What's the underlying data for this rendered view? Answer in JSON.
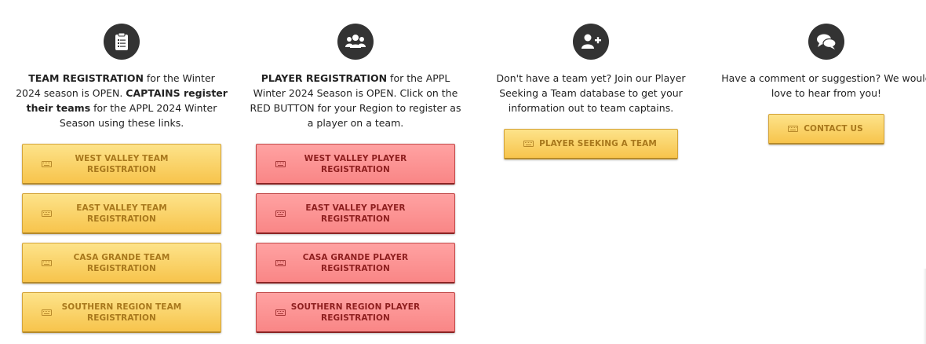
{
  "team": {
    "icon": "clipboard-icon",
    "desc_bold1": "TEAM REGISTRATION",
    "desc_text1": " for the Winter 2024 season is OPEN.  ",
    "desc_bold2": "CAPTAINS register their teams",
    "desc_text2": " for the APPL 2024 Winter Season using these links.",
    "buttons": [
      {
        "label": "WEST VALLEY TEAM REGISTRATION"
      },
      {
        "label": "EAST VALLEY TEAM REGISTRATION"
      },
      {
        "label": "CASA GRANDE TEAM REGISTRATION"
      },
      {
        "label": "SOUTHERN REGION TEAM REGISTRATION"
      }
    ]
  },
  "player": {
    "icon": "users-icon",
    "desc_bold": "PLAYER REGISTRATION",
    "desc_text": " for the APPL Winter 2024 Season is OPEN. Click on the RED BUTTON for your Region to register as a player on a team.",
    "buttons": [
      {
        "label": "WEST VALLEY PLAYER REGISTRATION"
      },
      {
        "label": "EAST VALLEY PLAYER REGISTRATION"
      },
      {
        "label": "CASA GRANDE PLAYER REGISTRATION"
      },
      {
        "label": "SOUTHERN REGION PLAYER REGISTRATION"
      }
    ]
  },
  "seeking": {
    "icon": "user-plus-icon",
    "desc": "Don't have a team yet? Join our Player Seeking a Team database to get your information out to team captains.",
    "button_label": "PLAYER SEEKING A TEAM"
  },
  "contact": {
    "icon": "chat-bubbles-icon",
    "desc": "Have a comment or suggestion? We would love to hear from you!",
    "button_label": "CONTACT US"
  },
  "colors": {
    "yellow_button": "#f9cd5e",
    "yellow_text": "#a8781c",
    "red_button": "#fc9393",
    "red_text": "#8e1f1f",
    "icon_circle": "#333333"
  },
  "button_icon": "keyboard-icon"
}
